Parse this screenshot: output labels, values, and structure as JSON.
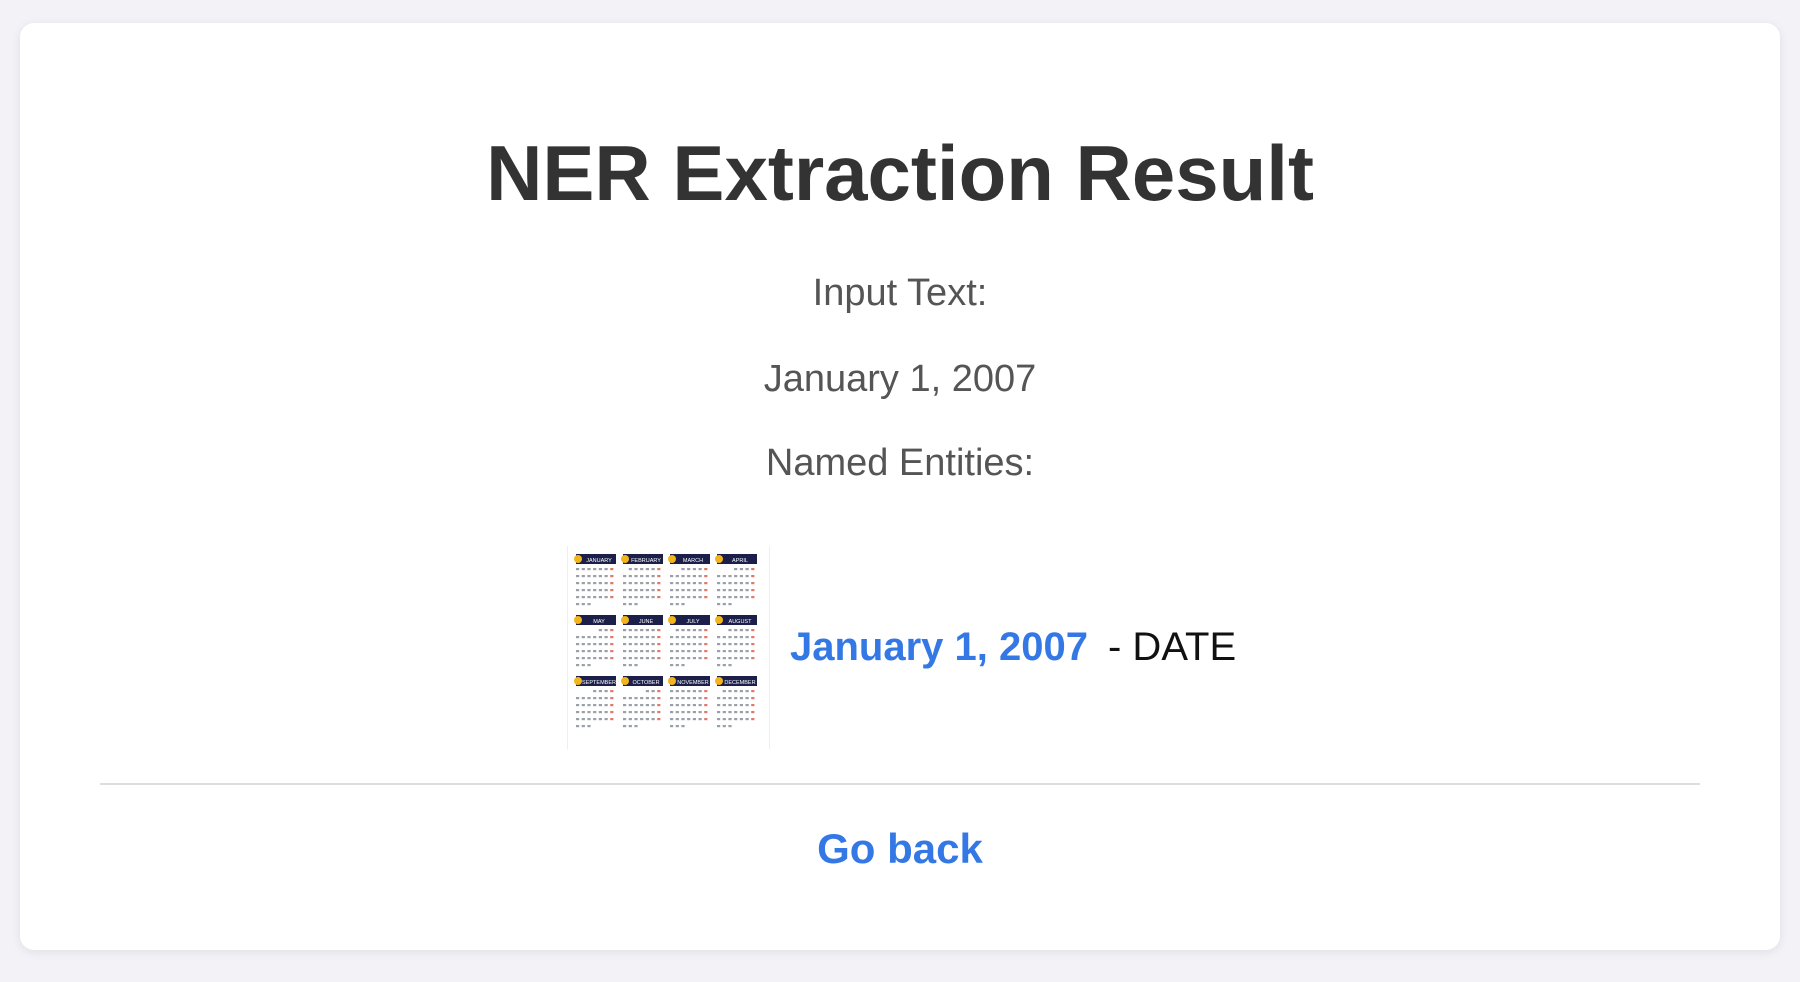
{
  "page": {
    "title": "NER Extraction Result",
    "input_label": "Input Text:",
    "input_text": "January 1, 2007",
    "entities_label": "Named Entities:"
  },
  "entities": [
    {
      "text": "January 1, 2007",
      "type_text": "- DATE"
    }
  ],
  "calendar_months": [
    "JANUARY",
    "FEBRUARY",
    "MARCH",
    "APRIL",
    "MAY",
    "JUNE",
    "JULY",
    "AUGUST",
    "SEPTEMBER",
    "OCTOBER",
    "NOVEMBER",
    "DECEMBER"
  ],
  "nav": {
    "back_label": "Go back"
  },
  "colors": {
    "accent": "#3478e5",
    "calendar_header": "#1b1f4a",
    "calendar_badge": "#f2b51b"
  }
}
